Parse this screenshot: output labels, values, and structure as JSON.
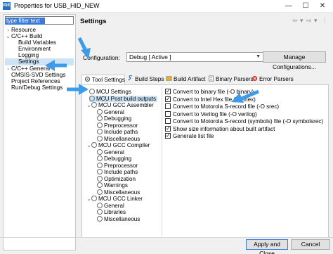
{
  "window": {
    "title": "Properties for USB_HID_NEW",
    "app_icon": "IDE",
    "controls": [
      "—",
      "☐",
      "✕"
    ]
  },
  "sidebar": {
    "filter_value": "type filter text",
    "items": [
      {
        "label": "Resource",
        "toggle": "›"
      },
      {
        "label": "C/C++ Build",
        "toggle": "⌄"
      },
      {
        "label": "Build Variables"
      },
      {
        "label": "Environment"
      },
      {
        "label": "Logging"
      },
      {
        "label": "Settings"
      },
      {
        "label": "C/C++ General",
        "toggle": "›"
      },
      {
        "label": "CMSIS-SVD Settings"
      },
      {
        "label": "Project References"
      },
      {
        "label": "Run/Debug Settings"
      }
    ]
  },
  "header": {
    "title": "Settings",
    "nav": [
      "⇦",
      "▾",
      "⇨",
      "▾",
      "⋮"
    ]
  },
  "config": {
    "label": "Configuration:",
    "value": "Debug  [ Active ]",
    "manage_label": "Manage Configurations..."
  },
  "tabs": [
    {
      "label": "Tool Settings",
      "icon": "tool-icon"
    },
    {
      "label": "Build Steps",
      "icon": "wrench-icon"
    },
    {
      "label": "Build Artifact",
      "icon": "artifact-icon"
    },
    {
      "label": "Binary Parsers",
      "icon": "binary-icon"
    },
    {
      "label": "Error Parsers",
      "icon": "error-icon"
    }
  ],
  "tree": {
    "mcu_settings": "MCU Settings",
    "mcu_post_build": "MCU Post build outputs",
    "assembler": "MCU GCC Assembler",
    "assembler_children": [
      "General",
      "Debugging",
      "Preprocessor",
      "Include paths",
      "Miscellaneous"
    ],
    "compiler": "MCU GCC Compiler",
    "compiler_children": [
      "General",
      "Debugging",
      "Preprocessor",
      "Include paths",
      "Optimization",
      "Warnings",
      "Miscellaneous"
    ],
    "linker": "MCU GCC Linker",
    "linker_children": [
      "General",
      "Libraries",
      "Miscellaneous"
    ]
  },
  "options": [
    {
      "label": "Convert to binary file (-O binary)",
      "checked": true
    },
    {
      "label": "Convert to Intel Hex file (-O ihex)",
      "checked": true
    },
    {
      "label": "Convert to Motorola S-record file (-O srec)",
      "checked": false
    },
    {
      "label": "Convert to Verilog file (-O verilog)",
      "checked": false
    },
    {
      "label": "Convert to Motorola S-record (symbols) file (-O symbolsrec)",
      "checked": false
    },
    {
      "label": "Show size information about built artifact",
      "checked": true
    },
    {
      "label": "Generate list file",
      "checked": true
    }
  ],
  "buttons": {
    "apply_close": "Apply and Close",
    "cancel": "Cancel"
  },
  "colors": {
    "annotation_arrow": "#3d9be9",
    "selection": "#cde4f7"
  }
}
